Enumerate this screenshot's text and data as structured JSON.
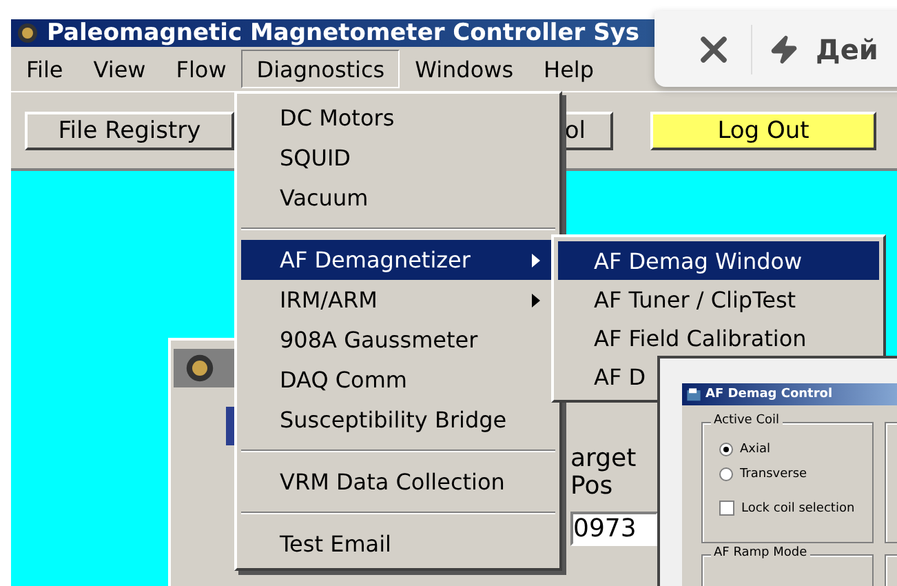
{
  "window": {
    "title": "Paleomagnetic Magnetometer Controller Sys"
  },
  "menu_bar": [
    {
      "label": "File",
      "selected": false
    },
    {
      "label": "View",
      "selected": false
    },
    {
      "label": "Flow",
      "selected": false
    },
    {
      "label": "Diagnostics",
      "selected": true
    },
    {
      "label": "Windows",
      "selected": false
    },
    {
      "label": "Help",
      "selected": false
    }
  ],
  "toolbar": [
    {
      "label": "File Registry",
      "kind": "plain"
    },
    {
      "label": "ol",
      "kind": "plain"
    },
    {
      "label": "Log Out",
      "kind": "highlight"
    }
  ],
  "overlay_panel": {
    "action": "Дей"
  },
  "background_window": {
    "labels": [
      "arget",
      "Pos"
    ],
    "value": "0973"
  },
  "diagnostics_menu": [
    {
      "kind": "item",
      "label": "DC Motors",
      "submenu": false,
      "selected": false
    },
    {
      "kind": "item",
      "label": "SQUID",
      "submenu": false,
      "selected": false
    },
    {
      "kind": "item",
      "label": "Vacuum",
      "submenu": false,
      "selected": false
    },
    {
      "kind": "separator"
    },
    {
      "kind": "item",
      "label": "AF Demagnetizer",
      "submenu": true,
      "selected": true
    },
    {
      "kind": "item",
      "label": "IRM/ARM",
      "submenu": true,
      "selected": false
    },
    {
      "kind": "item",
      "label": "908A Gaussmeter",
      "submenu": false,
      "selected": false
    },
    {
      "kind": "item",
      "label": "DAQ Comm",
      "submenu": false,
      "selected": false
    },
    {
      "kind": "item",
      "label": "Susceptibility Bridge",
      "submenu": false,
      "selected": false
    },
    {
      "kind": "separator"
    },
    {
      "kind": "item",
      "label": "VRM Data Collection",
      "submenu": false,
      "selected": false
    },
    {
      "kind": "separator"
    },
    {
      "kind": "item",
      "label": "Test Email",
      "submenu": false,
      "selected": false
    }
  ],
  "submenu": [
    {
      "label": "AF Demag Window",
      "selected": true
    },
    {
      "label": "AF Tuner / ClipTest",
      "selected": false
    },
    {
      "label": "AF Field Calibration",
      "selected": false
    },
    {
      "label": "AF D",
      "selected": false
    }
  ],
  "demag_window": {
    "title": "AF Demag Control",
    "active_coil": {
      "label": "Active Coil",
      "options": [
        {
          "label": "Axial",
          "selected": true
        },
        {
          "label": "Transverse",
          "selected": false
        }
      ],
      "lock": {
        "label": "Lock coil selection",
        "checked": false
      }
    },
    "ramp_mode": {
      "label": "AF Ramp Mode"
    }
  }
}
